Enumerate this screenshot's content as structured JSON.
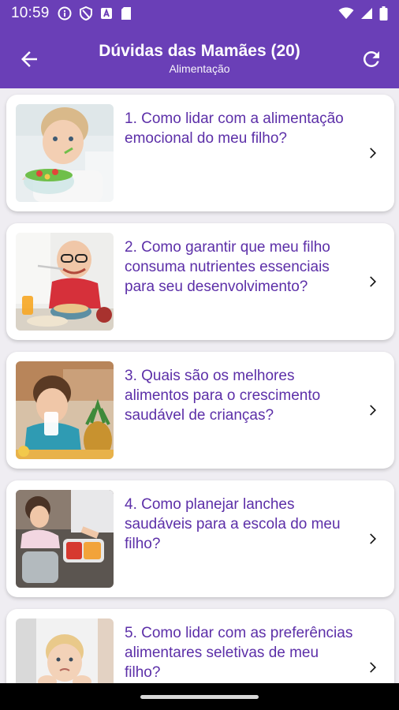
{
  "status_bar": {
    "time": "10:59",
    "icons_left": [
      "info-icon",
      "shield-icon",
      "font-icon",
      "sd-card-icon"
    ],
    "icons_right": [
      "wifi-icon",
      "signal-icon",
      "battery-icon"
    ]
  },
  "app_bar": {
    "title": "Dúvidas das Mamães (20)",
    "subtitle": "Alimentação",
    "back_icon": "arrow-back-icon",
    "refresh_icon": "refresh-icon"
  },
  "colors": {
    "primary": "#6a3fb7",
    "question_text": "#5c2fa8",
    "background": "#efedf2",
    "card": "#ffffff"
  },
  "questions": [
    {
      "text": "1. Como lidar com a alimentação emocional do meu filho?",
      "image": "child-eating-salad"
    },
    {
      "text": "2. Como garantir que meu filho consuma nutrientes essenciais para seu desenvolvimento?",
      "image": "boy-with-glasses-eating"
    },
    {
      "text": "3. Quais são os melhores alimentos para o crescimento saudável de crianças?",
      "image": "girl-drinking-milk-pineapple"
    },
    {
      "text": "4. Como planejar lanches saudáveis para a escola do meu filho?",
      "image": "lunchbox-preparation"
    },
    {
      "text": "5. Como lidar com as preferências alimentares seletivas de meu filho?",
      "image": "picky-eater-boy"
    }
  ]
}
